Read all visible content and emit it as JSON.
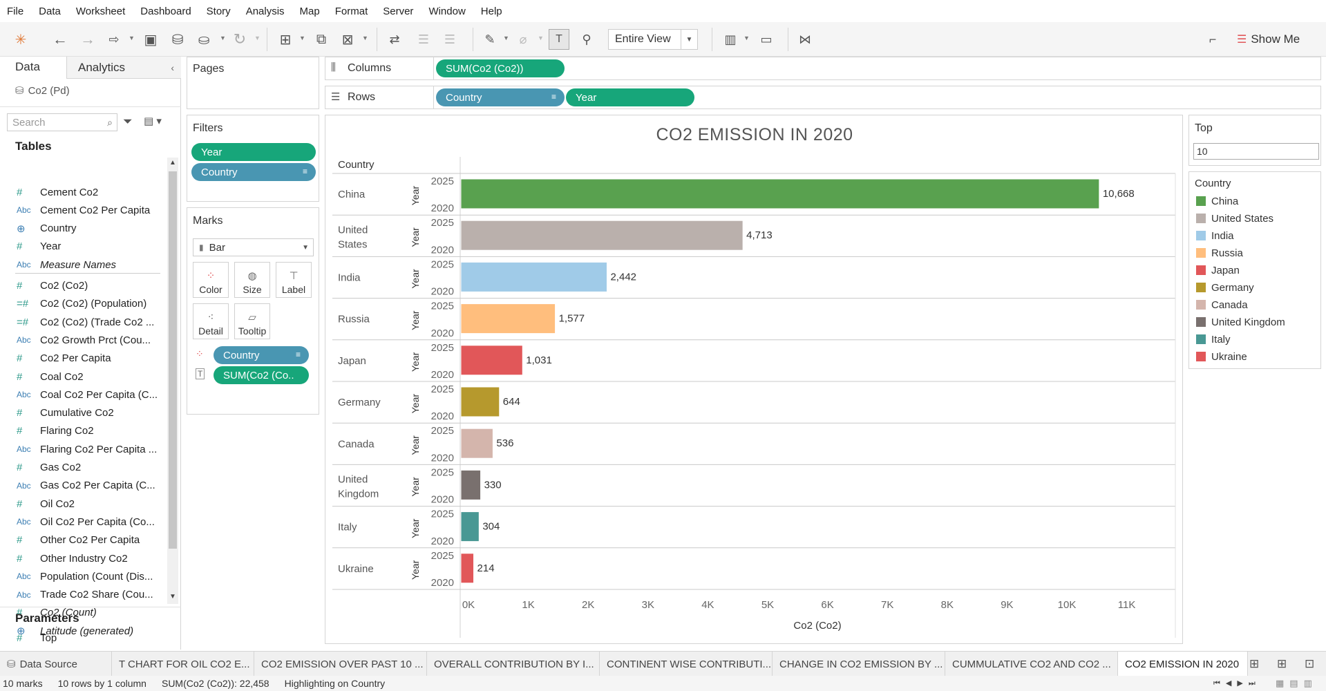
{
  "menu": [
    "File",
    "Data",
    "Worksheet",
    "Dashboard",
    "Story",
    "Analysis",
    "Map",
    "Format",
    "Server",
    "Window",
    "Help"
  ],
  "toolbar": {
    "view_select": "Entire View",
    "show_me": "Show Me"
  },
  "left_panel": {
    "tab_data": "Data",
    "tab_analytics": "Analytics",
    "datasource": "Co2 (Pd)",
    "search_placeholder": "Search",
    "tables_title": "Tables",
    "fields": [
      {
        "type": "#",
        "kind": "measure",
        "name": "Cement Co2",
        "italic": false
      },
      {
        "type": "Abc",
        "kind": "dim",
        "name": "Cement Co2 Per Capita",
        "italic": false
      },
      {
        "type": "geo",
        "kind": "geo",
        "name": "Country",
        "italic": false
      },
      {
        "type": "#",
        "kind": "measure",
        "name": "Year",
        "italic": false
      },
      {
        "type": "Abc",
        "kind": "dim",
        "name": "Measure Names",
        "italic": true
      },
      {
        "type": "#",
        "kind": "measure",
        "name": "Co2 (Co2)",
        "italic": false
      },
      {
        "type": "=#",
        "kind": "measure",
        "name": "Co2 (Co2) (Population)",
        "italic": false
      },
      {
        "type": "=#",
        "kind": "measure",
        "name": "Co2 (Co2) (Trade Co2 ...",
        "italic": false
      },
      {
        "type": "Abc",
        "kind": "dim",
        "name": "Co2 Growth Prct (Cou...",
        "italic": false
      },
      {
        "type": "#",
        "kind": "measure",
        "name": "Co2 Per Capita",
        "italic": false
      },
      {
        "type": "#",
        "kind": "measure",
        "name": "Coal Co2",
        "italic": false
      },
      {
        "type": "Abc",
        "kind": "dim",
        "name": "Coal Co2 Per Capita (C...",
        "italic": false
      },
      {
        "type": "#",
        "kind": "measure",
        "name": "Cumulative Co2",
        "italic": false
      },
      {
        "type": "#",
        "kind": "measure",
        "name": "Flaring Co2",
        "italic": false
      },
      {
        "type": "Abc",
        "kind": "dim",
        "name": "Flaring Co2 Per Capita ...",
        "italic": false
      },
      {
        "type": "#",
        "kind": "measure",
        "name": "Gas Co2",
        "italic": false
      },
      {
        "type": "Abc",
        "kind": "dim",
        "name": "Gas Co2 Per Capita (C...",
        "italic": false
      },
      {
        "type": "#",
        "kind": "measure",
        "name": "Oil Co2",
        "italic": false
      },
      {
        "type": "Abc",
        "kind": "dim",
        "name": "Oil Co2 Per Capita (Co...",
        "italic": false
      },
      {
        "type": "#",
        "kind": "measure",
        "name": "Other Co2 Per Capita",
        "italic": false
      },
      {
        "type": "#",
        "kind": "measure",
        "name": "Other Industry Co2",
        "italic": false
      },
      {
        "type": "Abc",
        "kind": "dim",
        "name": "Population (Count (Dis...",
        "italic": false
      },
      {
        "type": "Abc",
        "kind": "dim",
        "name": "Trade Co2 Share (Cou...",
        "italic": false
      },
      {
        "type": "#",
        "kind": "measure",
        "name": "Co2 (Count)",
        "italic": true
      },
      {
        "type": "geo",
        "kind": "geo",
        "name": "Latitude (generated)",
        "italic": true
      }
    ],
    "parameters_title": "Parameters",
    "parameters": [
      {
        "type": "#",
        "name": "Top"
      }
    ]
  },
  "shelves": {
    "pages_title": "Pages",
    "columns_label": "Columns",
    "columns_pill": "SUM(Co2 (Co2))",
    "rows_label": "Rows",
    "rows_pills": [
      "Country",
      "Year"
    ],
    "filters_title": "Filters",
    "filters": [
      "Year",
      "Country"
    ],
    "marks_title": "Marks",
    "mark_type": "Bar",
    "mark_buttons": [
      "Color",
      "Size",
      "Label",
      "Detail",
      "Tooltip"
    ],
    "mark_pills": [
      "Country",
      "SUM(Co2 (Co.."
    ]
  },
  "right_panel": {
    "top_title": "Top",
    "top_value": "10",
    "legend_title": "Country",
    "legend": [
      {
        "name": "China",
        "color": "#59a14f"
      },
      {
        "name": "United States",
        "color": "#bab0ac"
      },
      {
        "name": "India",
        "color": "#a0cbe8"
      },
      {
        "name": "Russia",
        "color": "#ffbe7d"
      },
      {
        "name": "Japan",
        "color": "#e15759"
      },
      {
        "name": "Germany",
        "color": "#b6992d"
      },
      {
        "name": "Canada",
        "color": "#d4b5ac"
      },
      {
        "name": "United Kingdom",
        "color": "#79706e"
      },
      {
        "name": "Italy",
        "color": "#499894"
      },
      {
        "name": "Ukraine",
        "color": "#e15759"
      }
    ]
  },
  "chart_data": {
    "type": "bar",
    "title": "CO2 EMISSION IN 2020",
    "row_header": "Country",
    "year_header": "Year",
    "year_ticks": [
      "2025",
      "2020"
    ],
    "xlabel": "Co2 (Co2)",
    "xlim": [
      0,
      12000
    ],
    "xticks": [
      "0K",
      "1K",
      "2K",
      "3K",
      "4K",
      "5K",
      "6K",
      "7K",
      "8K",
      "9K",
      "10K",
      "11K"
    ],
    "categories": [
      "China",
      "United States",
      "India",
      "Russia",
      "Japan",
      "Germany",
      "Canada",
      "United Kingdom",
      "Italy",
      "Ukraine"
    ],
    "category_lines": [
      [
        "China"
      ],
      [
        "United",
        "States"
      ],
      [
        "India"
      ],
      [
        "Russia"
      ],
      [
        "Japan"
      ],
      [
        "Germany"
      ],
      [
        "Canada"
      ],
      [
        "United",
        "Kingdom"
      ],
      [
        "Italy"
      ],
      [
        "Ukraine"
      ]
    ],
    "values": [
      10668,
      4713,
      2442,
      1577,
      1031,
      644,
      536,
      330,
      304,
      214
    ],
    "labels": [
      "10,668",
      "4,713",
      "2,442",
      "1,577",
      "1,031",
      "644",
      "536",
      "330",
      "304",
      "214"
    ],
    "colors": [
      "#59a14f",
      "#bab0ac",
      "#a0cbe8",
      "#ffbe7d",
      "#e15759",
      "#b6992d",
      "#d4b5ac",
      "#79706e",
      "#499894",
      "#e15759"
    ]
  },
  "sheet_tabs": {
    "datasource": "Data Source",
    "sheets": [
      "T CHART FOR OIL CO2 E...",
      "CO2 EMISSION OVER PAST 10 ...",
      "OVERALL CONTRIBUTION BY I...",
      "CONTINENT WISE CONTRIBUTI...",
      "CHANGE IN CO2 EMISSION BY ...",
      "CUMMULATIVE CO2 AND CO2 ...",
      "CO2 EMISSION IN 2020"
    ],
    "active": "CO2 EMISSION IN 2020"
  },
  "status": {
    "marks": "10 marks",
    "rows": "10 rows by 1 column",
    "sum": "SUM(Co2 (Co2)): 22,458",
    "highlight": "Highlighting on Country"
  }
}
